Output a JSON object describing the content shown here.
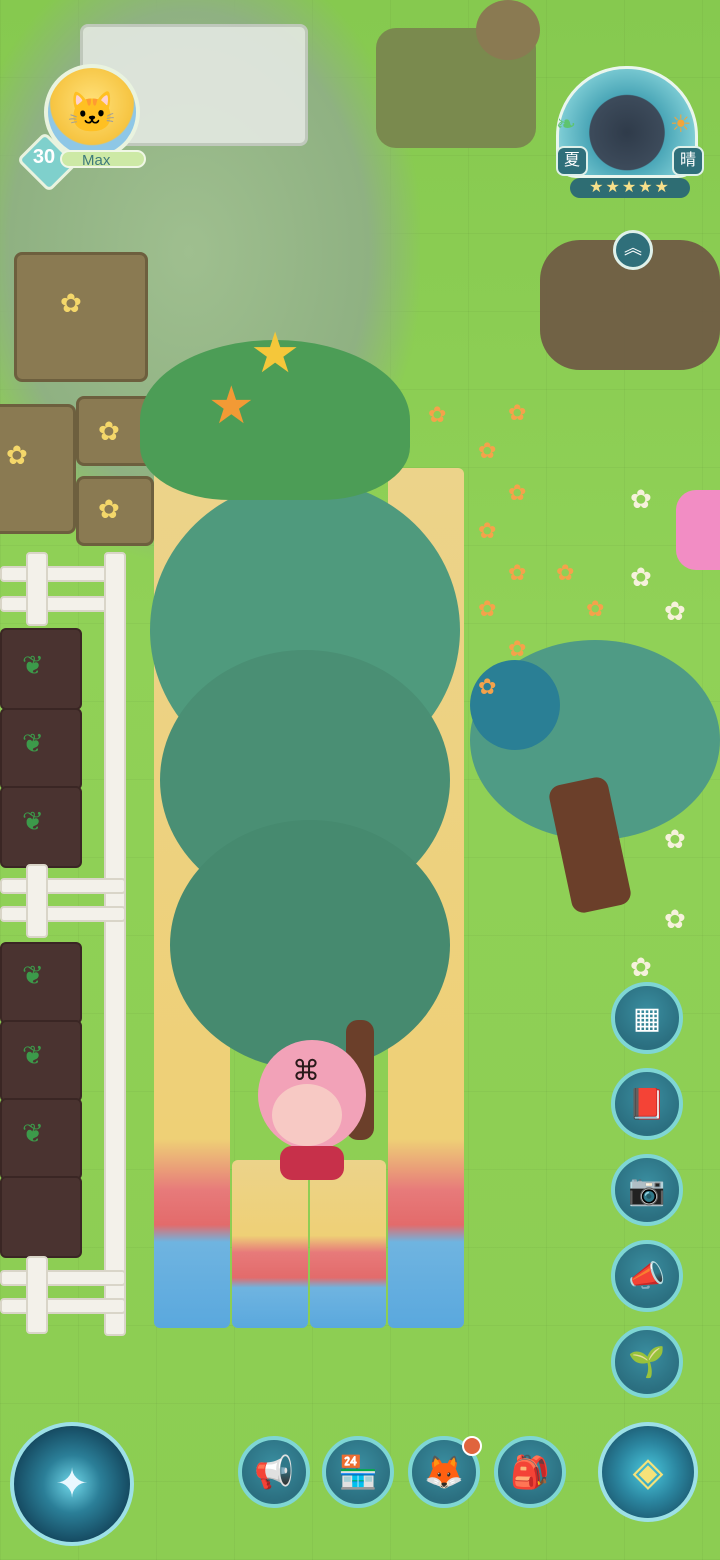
{
  "player": {
    "level": "30",
    "name": "Max"
  },
  "weather": {
    "season": "夏",
    "sky": "晴",
    "stars": "★★★★★"
  },
  "icons": {
    "avatar": "cat-avatar-icon",
    "expand": "chevron-up-icon",
    "side_buttons": [
      "layout-icon",
      "album-icon",
      "camera-icon",
      "megaphone-toy-icon",
      "sprout-icon"
    ],
    "bottom_buttons": [
      "compass-icon",
      "megaphone-icon",
      "shop-icon",
      "fox-icon",
      "backpack-icon",
      "navigation-icon"
    ]
  },
  "colors": {
    "hud_teal": "#2b6f80",
    "hud_border": "#7fd6d4",
    "notification": "#e0643d",
    "grass": "#8fcf55"
  }
}
